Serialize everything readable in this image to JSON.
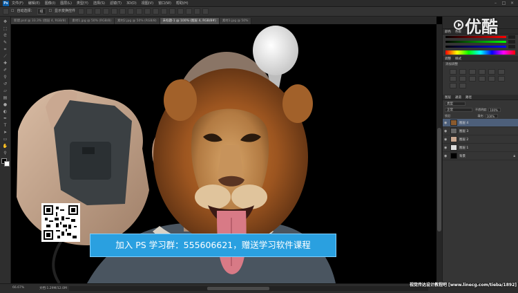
{
  "menubar": {
    "logo": "Ps",
    "items": [
      "文件(F)",
      "编辑(E)",
      "图像(I)",
      "图层(L)",
      "类型(Y)",
      "选择(S)",
      "滤镜(T)",
      "3D(D)",
      "视图(V)",
      "窗口(W)",
      "帮助(H)"
    ],
    "minimize": "–",
    "maximize": "□",
    "close": "×"
  },
  "options": {
    "auto_select_label": "自动选择：",
    "auto_select_value": "组",
    "show_transform_label": "显示变换控件"
  },
  "tabs": [
    {
      "label": "新建.psd @ 33.3% (图层 4, RGB/8)"
    },
    {
      "label": "素材1.jpg @ 50% (RGB/8)"
    },
    {
      "label": "素材2.jpg @ 50% (RGB/8)"
    },
    {
      "label": "未标题-1 @ 100% (图层 4, RGB/8#)",
      "active": true
    },
    {
      "label": "素材3.jpg @ 50%"
    }
  ],
  "panels": {
    "color_tabs": [
      "颜色",
      "色板"
    ],
    "adjust_tabs": [
      "调整",
      "样式"
    ],
    "adjust_hint": "添加调整",
    "layer_tabs": [
      "图层",
      "通道",
      "路径"
    ],
    "filter_kind": "类型",
    "blend_mode": "正常",
    "opacity_label": "不透明度:",
    "opacity_value": "100%",
    "lock_label": "锁定:",
    "fill_label": "填充:",
    "fill_value": "100%",
    "layers": [
      {
        "name": "图层 4",
        "active": true
      },
      {
        "name": "图层 3"
      },
      {
        "name": "图层 2"
      },
      {
        "name": "图层 1"
      },
      {
        "name": "背景",
        "locked": true
      }
    ]
  },
  "status": {
    "zoom": "66.67%",
    "doc": "文档:1.29M/12.0M"
  },
  "overlay": {
    "watermark": "优酷",
    "promo": "加入 PS 学习群：555606621，赠送学习软件课程",
    "credit": "视觉传达设计教程吧 [www.linecg.com/tieba/1892]"
  },
  "colors": {
    "promo_bg": "#2aa0e0",
    "active_layer": "#4d5f7a",
    "ps_blue": "#0b5ea8"
  }
}
